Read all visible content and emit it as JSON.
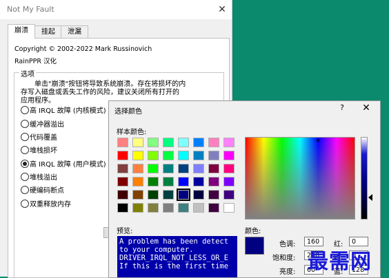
{
  "main_window": {
    "title": "Not My Fault",
    "close_glyph": "✕",
    "tabs": [
      {
        "label": "崩溃"
      },
      {
        "label": "挂起"
      },
      {
        "label": "泄漏"
      }
    ],
    "copyright": "Copyright © 2002-2022 Mark Russinovich",
    "translator": "RainPPR 汉化",
    "options_label": "选项",
    "description_lines": [
      "单击\"崩溃\"按钮将导致系统崩溃。存在将损坏的内",
      "存写入磁盘或丢失工作的风险，建议关闭所有打开的",
      "应用程序。"
    ],
    "options": [
      {
        "label": "高 IRQL 故障 (内核模式)",
        "selected": false
      },
      {
        "label": "缓冲器溢出",
        "selected": false
      },
      {
        "label": "代码覆盖",
        "selected": false
      },
      {
        "label": "堆栈损坏",
        "selected": false
      },
      {
        "label": "高 IRQL 故障 (用户模式)",
        "selected": true
      },
      {
        "label": "堆栈溢出",
        "selected": false
      },
      {
        "label": "硬编码断点",
        "selected": false
      },
      {
        "label": "双重释放内存",
        "selected": false
      }
    ]
  },
  "color_dialog": {
    "title": "选择颜色",
    "help_glyph": "?",
    "close_glyph": "✕",
    "basic_colors_label": "样本颜色:",
    "basic_colors": [
      [
        "#ff8080",
        "#ffff80",
        "#80ff80",
        "#00ff80",
        "#80ffff",
        "#0080ff",
        "#ff80c0",
        "#ff80ff"
      ],
      [
        "#ff0000",
        "#ffff00",
        "#80ff00",
        "#00ff40",
        "#00ffff",
        "#0080c0",
        "#8080c0",
        "#ff00ff"
      ],
      [
        "#804040",
        "#ff8040",
        "#00ff00",
        "#008080",
        "#004080",
        "#8080ff",
        "#800040",
        "#ff0080"
      ],
      [
        "#800000",
        "#ff8000",
        "#008000",
        "#008040",
        "#0000ff",
        "#0000a0",
        "#800080",
        "#8000ff"
      ],
      [
        "#400000",
        "#804000",
        "#004000",
        "#004040",
        "#000080",
        "#000040",
        "#400040",
        "#400080"
      ],
      [
        "#000000",
        "#808000",
        "#808040",
        "#808080",
        "#408080",
        "#c0c0c0",
        "#400040",
        "#ffffff"
      ]
    ],
    "selected_swatch_row": 4,
    "selected_swatch_col": 4,
    "preview_label": "预览:",
    "preview_lines": [
      "A problem has been detect",
      "to your computer.",
      "",
      "DRIVER_IRQL_NOT_LESS_OR_E",
      "",
      "If this is the first time"
    ],
    "color_label": "颜色:",
    "hue_label": "色调:",
    "hue": "160",
    "sat_label": "饱和度:",
    "sat": "240",
    "lum_label": "亮度:",
    "lum": "60",
    "red_label": "红:",
    "red": "0",
    "green_label": "绿:",
    "green": "0",
    "blue_label": "蓝:",
    "blue": "128",
    "current_color": "#000080",
    "crosshair_glyph": "⌖"
  },
  "watermark": "最需网"
}
